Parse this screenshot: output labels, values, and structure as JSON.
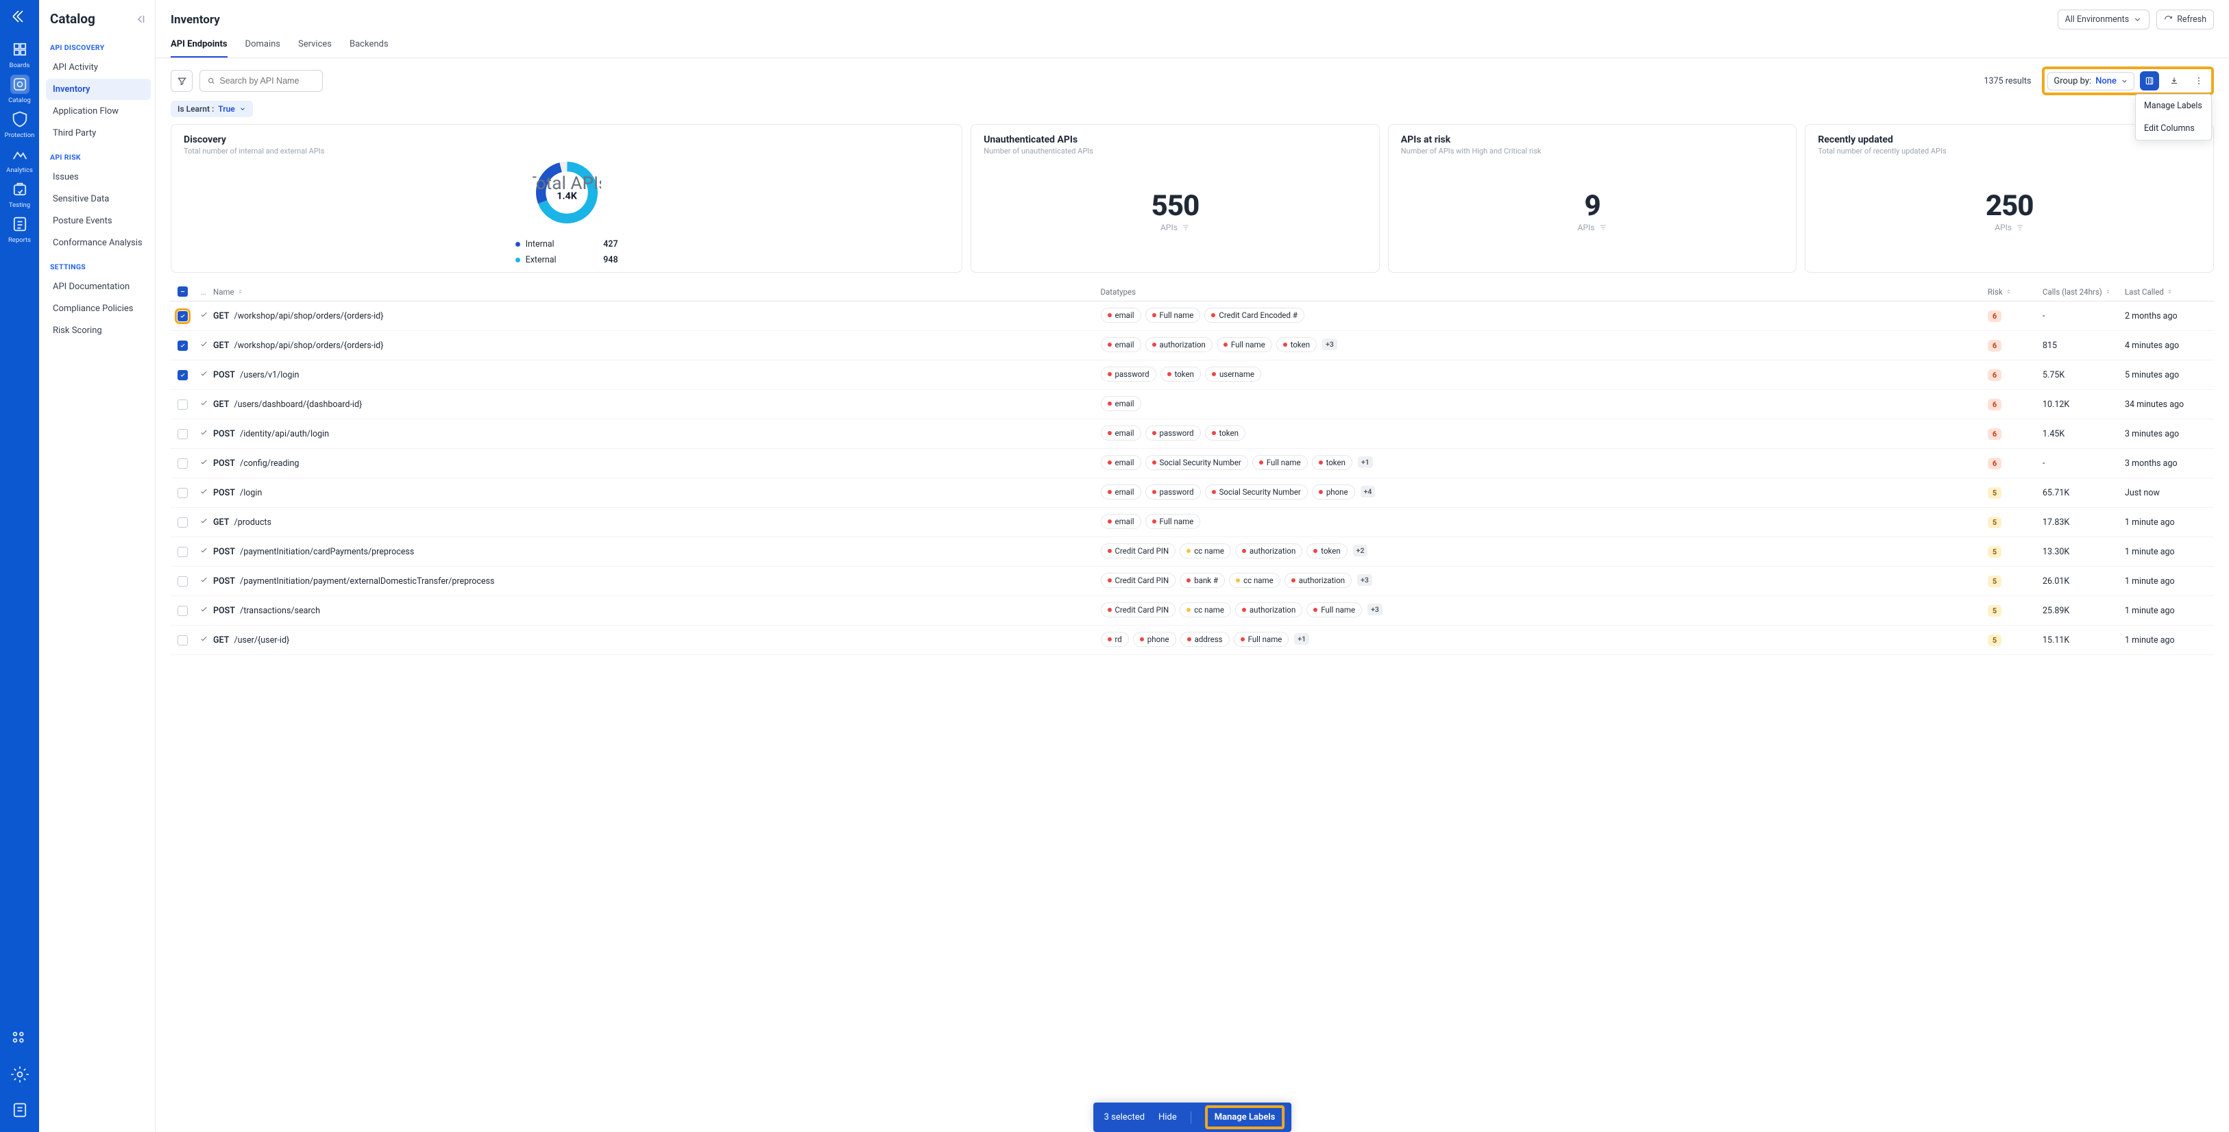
{
  "rail": {
    "items": [
      {
        "label": "Boards"
      },
      {
        "label": "Catalog"
      },
      {
        "label": "Protection"
      },
      {
        "label": "Analytics"
      },
      {
        "label": "Testing"
      },
      {
        "label": "Reports"
      }
    ]
  },
  "sidebar": {
    "title": "Catalog",
    "sections": [
      {
        "heading": "API DISCOVERY",
        "items": [
          "API Activity",
          "Inventory",
          "Application Flow",
          "Third Party"
        ]
      },
      {
        "heading": "API RISK",
        "items": [
          "Issues",
          "Sensitive Data",
          "Posture Events",
          "Conformance Analysis"
        ]
      },
      {
        "heading": "SETTINGS",
        "items": [
          "API Documentation",
          "Compliance Policies",
          "Risk Scoring"
        ]
      }
    ],
    "active": "Inventory"
  },
  "header": {
    "title": "Inventory",
    "env_button": "All Environments",
    "refresh": "Refresh",
    "tabs": [
      "API Endpoints",
      "Domains",
      "Services",
      "Backends"
    ],
    "active_tab": "API Endpoints"
  },
  "toolbar": {
    "search_placeholder": "Search by API Name",
    "results": "1375 results",
    "groupby_label": "Group by:",
    "groupby_value": "None",
    "menu": [
      "Manage Labels",
      "Edit Columns"
    ]
  },
  "filter_chip": {
    "label": "Is Learnt :",
    "value": "True"
  },
  "cards": {
    "discovery": {
      "title": "Discovery",
      "sub": "Total number of internal and external APIs",
      "total_label": "Total APIs",
      "total": "1.4K",
      "legend": [
        {
          "label": "Internal",
          "count": "427",
          "color": "#1d54c9"
        },
        {
          "label": "External",
          "count": "948",
          "color": "#1bb4e6"
        }
      ]
    },
    "unauth": {
      "title": "Unauthenticated APIs",
      "sub": "Number of unauthenticated APIs",
      "value": "550",
      "unit": "APIs"
    },
    "risk": {
      "title": "APIs at risk",
      "sub": "Number of APIs with High and Critical risk",
      "value": "9",
      "unit": "APIs"
    },
    "recent": {
      "title": "Recently updated",
      "sub": "Total number of recently updated APIs",
      "value": "250",
      "unit": "APIs"
    }
  },
  "chart_data": {
    "type": "pie",
    "title": "Discovery",
    "categories": [
      "Internal",
      "External"
    ],
    "values": [
      427,
      948
    ],
    "colors": [
      "#1d54c9",
      "#1bb4e6"
    ],
    "total_label": "1.4K"
  },
  "columns": {
    "name": "Name",
    "data": "Datatypes",
    "risk": "Risk",
    "calls": "Calls (last 24hrs)",
    "last": "Last Called"
  },
  "rows": [
    {
      "sel": true,
      "hl": true,
      "method": "GET",
      "path": "/workshop/api/shop/orders/{orders-id}",
      "tags": [
        {
          "t": "email",
          "c": "red"
        },
        {
          "t": "Full name",
          "c": "red"
        },
        {
          "t": "Credit Card Encoded #",
          "c": "red"
        }
      ],
      "more": null,
      "risk": "6",
      "calls": "-",
      "last": "2 months ago"
    },
    {
      "sel": true,
      "method": "GET",
      "path": "/workshop/api/shop/orders/{orders-id}",
      "tags": [
        {
          "t": "email",
          "c": "red"
        },
        {
          "t": "authorization",
          "c": "red"
        },
        {
          "t": "Full name",
          "c": "red"
        },
        {
          "t": "token",
          "c": "red"
        }
      ],
      "more": "+3",
      "risk": "6",
      "calls": "815",
      "last": "4 minutes ago"
    },
    {
      "sel": true,
      "method": "POST",
      "path": "/users/v1/login",
      "tags": [
        {
          "t": "password",
          "c": "red"
        },
        {
          "t": "token",
          "c": "red"
        },
        {
          "t": "username",
          "c": "red"
        }
      ],
      "more": null,
      "risk": "6",
      "calls": "5.75K",
      "last": "5 minutes ago"
    },
    {
      "sel": false,
      "method": "GET",
      "path": "/users/dashboard/{dashboard-id}",
      "tags": [
        {
          "t": "email",
          "c": "red"
        }
      ],
      "more": null,
      "risk": "6",
      "calls": "10.12K",
      "last": "34 minutes ago"
    },
    {
      "sel": false,
      "method": "POST",
      "path": "/identity/api/auth/login",
      "tags": [
        {
          "t": "email",
          "c": "red"
        },
        {
          "t": "password",
          "c": "red"
        },
        {
          "t": "token",
          "c": "red"
        }
      ],
      "more": null,
      "risk": "6",
      "calls": "1.45K",
      "last": "3 minutes ago"
    },
    {
      "sel": false,
      "method": "POST",
      "path": "/config/reading",
      "tags": [
        {
          "t": "email",
          "c": "red"
        },
        {
          "t": "Social Security Number",
          "c": "red"
        },
        {
          "t": "Full name",
          "c": "red"
        },
        {
          "t": "token",
          "c": "red"
        }
      ],
      "more": "+1",
      "risk": "6",
      "calls": "-",
      "last": "3 months ago"
    },
    {
      "sel": false,
      "method": "POST",
      "path": "/login",
      "tags": [
        {
          "t": "email",
          "c": "red"
        },
        {
          "t": "password",
          "c": "red"
        },
        {
          "t": "Social Security Number",
          "c": "red"
        },
        {
          "t": "phone",
          "c": "red"
        }
      ],
      "more": "+4",
      "risk": "5",
      "calls": "65.71K",
      "last": "Just now"
    },
    {
      "sel": false,
      "method": "GET",
      "path": "/products",
      "tags": [
        {
          "t": "email",
          "c": "red"
        },
        {
          "t": "Full name",
          "c": "red"
        }
      ],
      "more": null,
      "risk": "5",
      "calls": "17.83K",
      "last": "1 minute ago"
    },
    {
      "sel": false,
      "method": "POST",
      "path": "/paymentInitiation/cardPayments/preprocess",
      "tags": [
        {
          "t": "Credit Card PIN",
          "c": "red"
        },
        {
          "t": "cc name",
          "c": "yellow"
        },
        {
          "t": "authorization",
          "c": "red"
        },
        {
          "t": "token",
          "c": "red"
        }
      ],
      "more": "+2",
      "risk": "5",
      "calls": "13.30K",
      "last": "1 minute ago"
    },
    {
      "sel": false,
      "method": "POST",
      "path": "/paymentInitiation/payment/externalDomesticTransfer/preprocess",
      "tags": [
        {
          "t": "Credit Card PIN",
          "c": "red"
        },
        {
          "t": "bank #",
          "c": "red"
        },
        {
          "t": "cc name",
          "c": "yellow"
        },
        {
          "t": "authorization",
          "c": "red"
        }
      ],
      "more": "+3",
      "risk": "5",
      "calls": "26.01K",
      "last": "1 minute ago"
    },
    {
      "sel": false,
      "method": "POST",
      "path": "/transactions/search",
      "tags": [
        {
          "t": "Credit Card PIN",
          "c": "red"
        },
        {
          "t": "cc name",
          "c": "yellow"
        },
        {
          "t": "authorization",
          "c": "red"
        },
        {
          "t": "Full name",
          "c": "red"
        }
      ],
      "more": "+3",
      "risk": "5",
      "calls": "25.89K",
      "last": "1 minute ago"
    },
    {
      "sel": false,
      "method": "GET",
      "path": "/user/{user-id}",
      "tags": [
        {
          "t": "rd",
          "c": "red"
        },
        {
          "t": "phone",
          "c": "red"
        },
        {
          "t": "address",
          "c": "red"
        },
        {
          "t": "Full name",
          "c": "red"
        }
      ],
      "more": "+1",
      "risk": "5",
      "calls": "15.11K",
      "last": "1 minute ago"
    }
  ],
  "selbar": {
    "count": "3 selected",
    "hide": "Hide",
    "manage": "Manage Labels"
  }
}
